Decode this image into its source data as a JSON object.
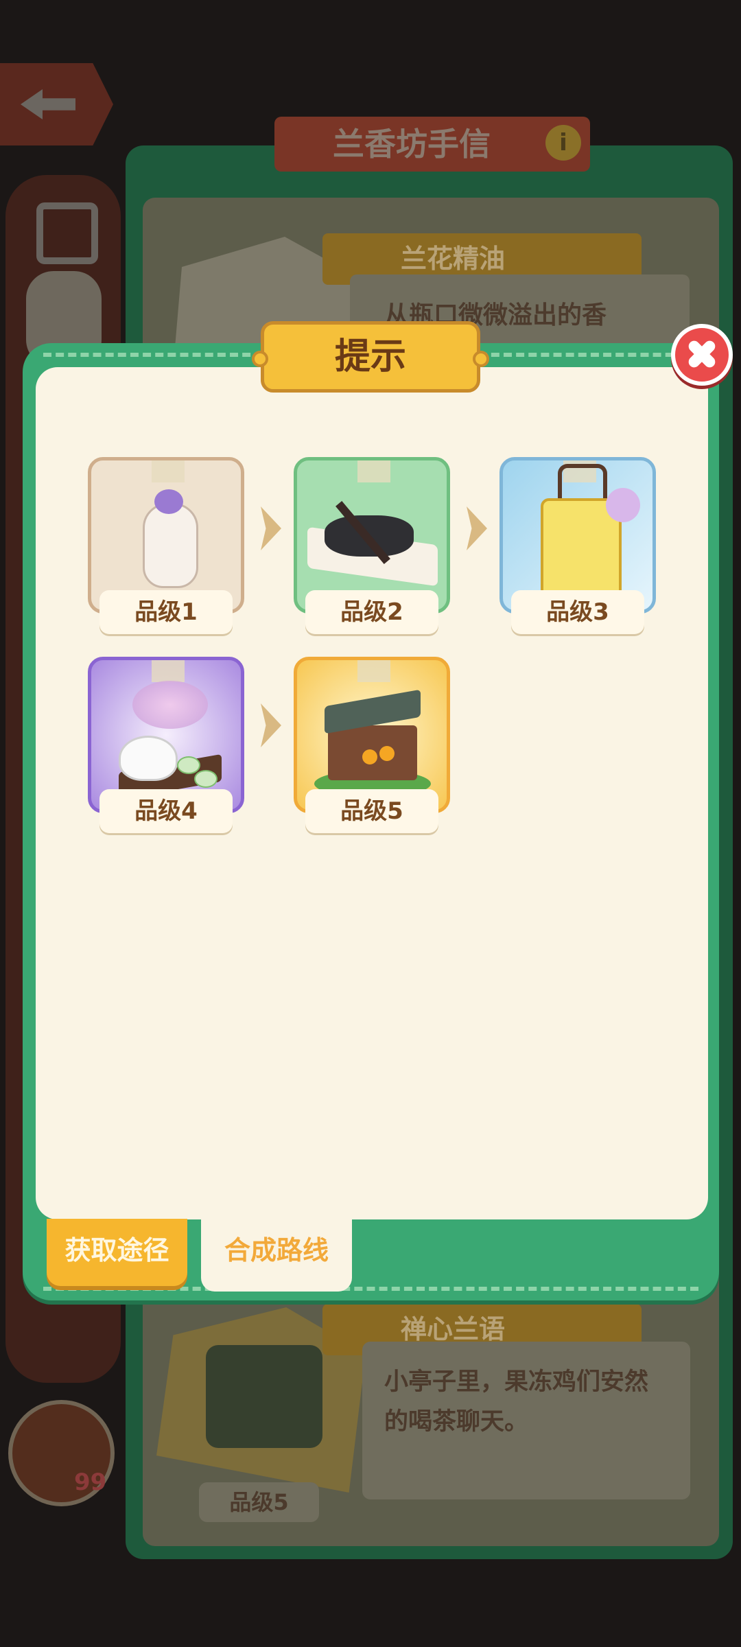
{
  "background": {
    "book_title": "兰香坊手信",
    "info_symbol": "i",
    "top_item": {
      "name": "兰花精油",
      "description": "从瓶口微微溢出的香"
    },
    "bottom_item": {
      "name": "禅心兰语",
      "description": "小亭子里，果冻鸡们安然的喝茶聊天。",
      "grade": "品级5"
    },
    "hand_count": "99"
  },
  "dialog": {
    "title": "提示",
    "grades": [
      {
        "label": "品级1",
        "art": "orchid essential oil bottle"
      },
      {
        "label": "品级2",
        "art": "ink stone with brush and scroll"
      },
      {
        "label": "品级3",
        "art": "yellow lantern with orchids"
      },
      {
        "label": "品级4",
        "art": "teapot set with orchid"
      },
      {
        "label": "品级5",
        "art": "garden pavilion with chicks"
      }
    ],
    "tabs": {
      "obtain": "获取途径",
      "route": "合成路线"
    }
  },
  "colors": {
    "dialog_green": "#3aa873",
    "panel_cream": "#faf4e4",
    "title_gold": "#f5c03a",
    "close_red": "#ea4b4b",
    "tab_active_text": "#f2a93a"
  },
  "icons": {
    "back": "back-arrow-icon",
    "close": "close-icon",
    "info": "info-icon",
    "link": "link-icon",
    "hand": "hand-icon"
  }
}
